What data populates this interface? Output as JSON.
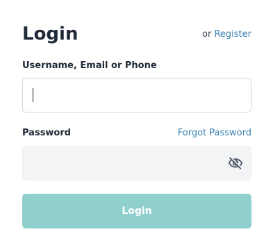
{
  "header": {
    "title": "Login",
    "or_text": "or",
    "register_label": "Register"
  },
  "username": {
    "label": "Username, Email or Phone",
    "value": "",
    "placeholder": ""
  },
  "password": {
    "label": "Password",
    "forgot_label": "Forgot Password",
    "value": "",
    "placeholder": "",
    "toggle_icon": "eye-off-icon"
  },
  "submit": {
    "label": "Login",
    "disabled": true
  },
  "colors": {
    "link": "#3b82b0",
    "button_bg": "#8fd0cf",
    "password_bg": "#f3f4f6",
    "title": "#1f2937"
  }
}
